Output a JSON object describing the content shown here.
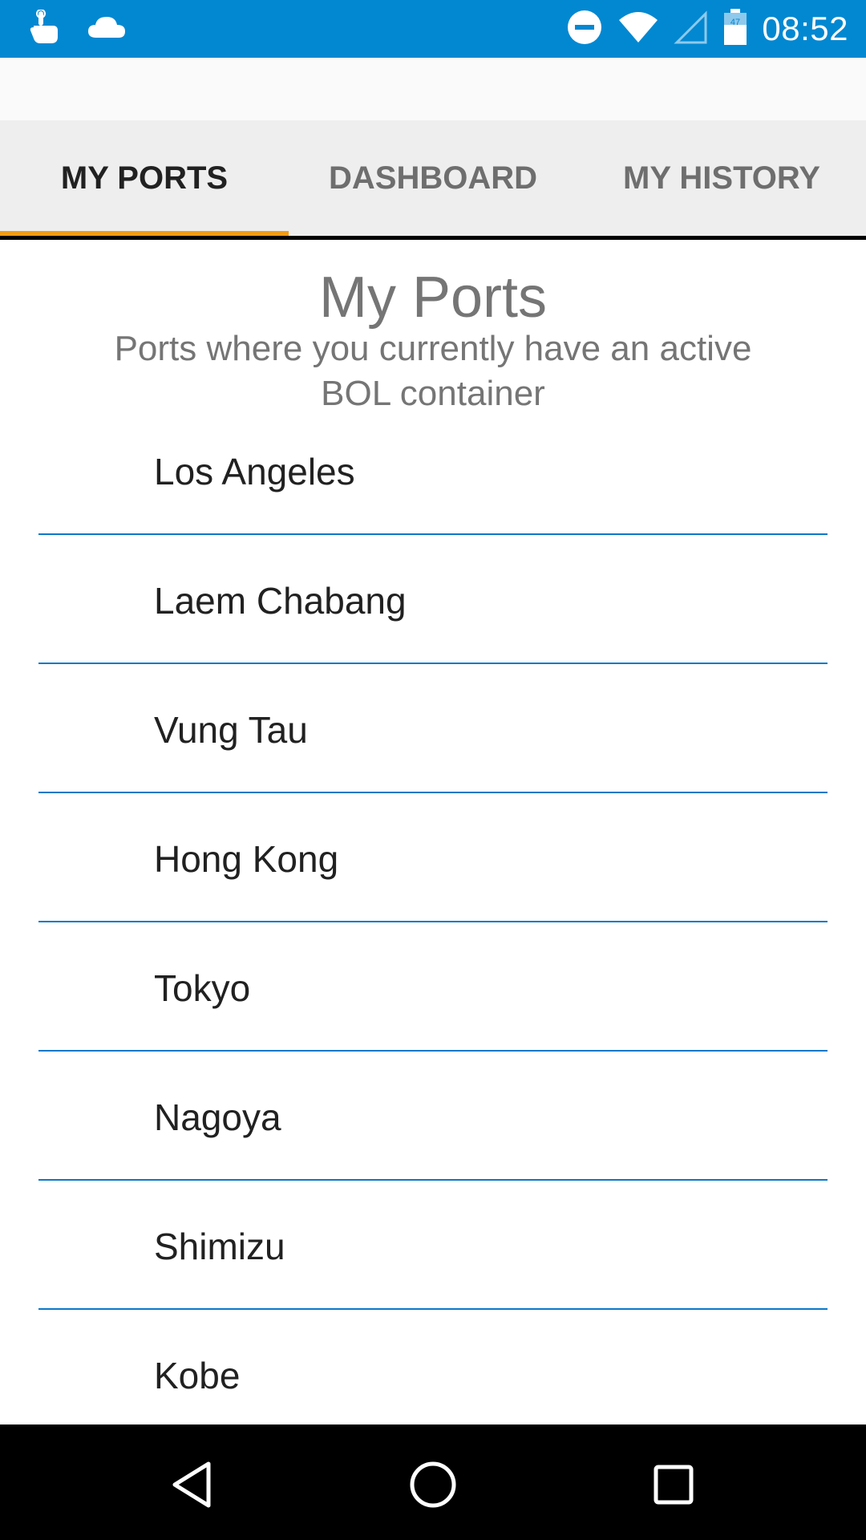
{
  "status_bar": {
    "time": "08:52",
    "battery_level": "47",
    "icons": [
      "touch-notification-icon",
      "cloud-icon",
      "do-not-disturb-icon",
      "wifi-icon",
      "cellular-signal-icon",
      "battery-icon"
    ],
    "background_color": "#0288d1"
  },
  "tabs": [
    {
      "label": "MY PORTS",
      "active": true
    },
    {
      "label": "DASHBOARD",
      "active": false
    },
    {
      "label": "MY HISTORY",
      "active": false
    }
  ],
  "accent_color": "#f39c12",
  "divider_color": "#0a78c8",
  "page": {
    "title": "My Ports",
    "subtitle": "Ports where you currently have an active BOL container"
  },
  "ports": [
    {
      "name": "Los Angeles"
    },
    {
      "name": "Laem Chabang"
    },
    {
      "name": "Vung Tau"
    },
    {
      "name": "Hong Kong"
    },
    {
      "name": "Tokyo"
    },
    {
      "name": "Nagoya"
    },
    {
      "name": "Shimizu"
    },
    {
      "name": "Kobe"
    }
  ],
  "nav_bar": {
    "buttons": [
      "back-icon",
      "home-icon",
      "recents-icon"
    ]
  }
}
